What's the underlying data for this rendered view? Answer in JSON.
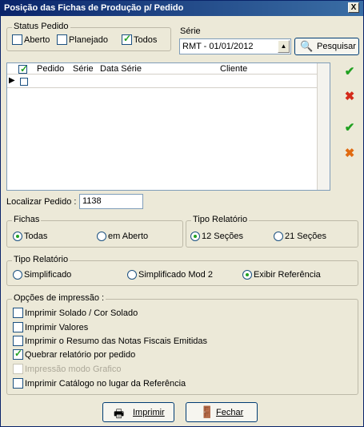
{
  "window": {
    "title": "Posição das Fichas de Produção p/ Pedido",
    "close_label": "X"
  },
  "status_pedido": {
    "label": "Status Pedido",
    "options": [
      {
        "label": "Aberto",
        "checked": false
      },
      {
        "label": "Planejado",
        "checked": false
      },
      {
        "label": "Todos",
        "checked": true
      }
    ]
  },
  "serie": {
    "label": "Série",
    "value": "RMT - 01/01/2012"
  },
  "search_button": {
    "label": "Pesquisar"
  },
  "grid": {
    "columns": [
      "Pedido",
      "Série",
      "Data Série",
      "Cliente"
    ],
    "rows": [
      {
        "selected": false
      }
    ]
  },
  "localizar": {
    "label": "Localizar Pedido :",
    "value": "1138"
  },
  "fichas": {
    "label": "Fichas",
    "options": [
      {
        "label": "Todas",
        "checked": true
      },
      {
        "label": "em Aberto",
        "checked": false
      }
    ]
  },
  "tipo_relatorio_1": {
    "label": "Tipo Relatório",
    "options": [
      {
        "label": "12 Seções",
        "checked": true
      },
      {
        "label": "21 Seções",
        "checked": false
      }
    ]
  },
  "tipo_relatorio_2": {
    "label": "Tipo Relatório",
    "options": [
      {
        "label": "Simplificado",
        "checked": false
      },
      {
        "label": "Simplificado Mod 2",
        "checked": false
      },
      {
        "label": "Exibir Referência",
        "checked": true
      }
    ]
  },
  "opcoes_impressao": {
    "label": "Opções de impressão :",
    "options": [
      {
        "label": "Imprimir Solado / Cor Solado",
        "checked": false,
        "enabled": true
      },
      {
        "label": "Imprimir Valores",
        "checked": false,
        "enabled": true
      },
      {
        "label": "Imprimir o Resumo das Notas Fiscais Emitidas",
        "checked": false,
        "enabled": true
      },
      {
        "label": "Quebrar relatório por pedido",
        "checked": true,
        "enabled": true
      },
      {
        "label": "Impressão modo Grafico",
        "checked": false,
        "enabled": false
      },
      {
        "label": "Imprimir Catálogo no lugar da Referência",
        "checked": false,
        "enabled": true
      }
    ]
  },
  "buttons": {
    "print_label": "Imprimir",
    "close_label": "Fechar"
  },
  "colors": {
    "accent_green": "#21a121",
    "accent_red": "#d42a1a",
    "title_blue": "#0a246a"
  }
}
